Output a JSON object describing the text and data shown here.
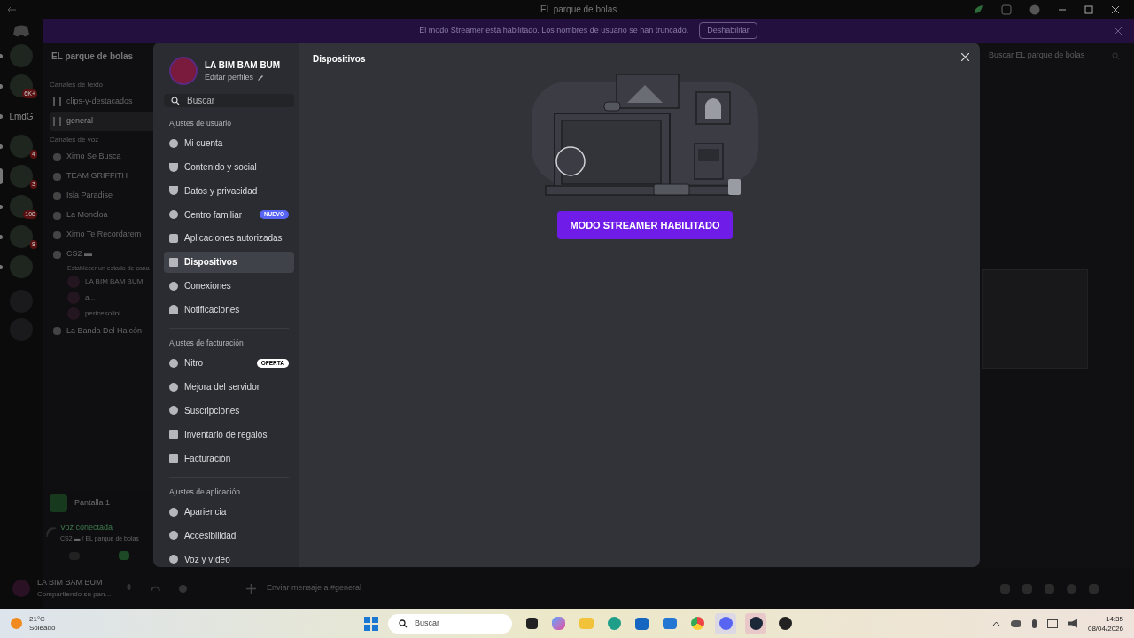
{
  "window": {
    "title": "EL parque de bolas"
  },
  "banner": {
    "text": "El modo Streamer está habilitado. Los nombres de usuario se han truncado.",
    "button": "Deshabilitar"
  },
  "server_rail": {
    "items": [
      {
        "kind": "server",
        "selected": false
      },
      {
        "kind": "server",
        "badge": "6K+",
        "selected": false
      },
      {
        "kind": "text",
        "label": "LmdG",
        "selected": false
      },
      {
        "kind": "server",
        "badge": "4",
        "selected": false
      },
      {
        "kind": "server",
        "badge": "3",
        "selected": true
      },
      {
        "kind": "server",
        "badge": "108",
        "selected": false
      },
      {
        "kind": "server",
        "badge": "8",
        "selected": false
      },
      {
        "kind": "server",
        "selected": false
      }
    ]
  },
  "channels": {
    "server_name": "EL parque de bolas",
    "groups": [
      {
        "title": "Canales de texto",
        "items": [
          {
            "kind": "text",
            "name": "clips-y-destacados",
            "selected": false
          },
          {
            "kind": "text",
            "name": "general",
            "selected": true
          }
        ]
      },
      {
        "title": "Canales de voz",
        "items": [
          {
            "kind": "voice",
            "name": "Ximo Se Busca",
            "selected": false
          },
          {
            "kind": "voice",
            "name": "TEAM GRIFFITH",
            "selected": false
          },
          {
            "kind": "voice",
            "name": "Isla Paradise",
            "selected": false
          },
          {
            "kind": "voice",
            "name": "La Moncloa",
            "selected": false
          },
          {
            "kind": "voice",
            "name": "Ximo Te Recordarem",
            "selected": false
          },
          {
            "kind": "voice",
            "name": "CS2 ▬",
            "status": "Establecer un estado de cana",
            "selected": false,
            "children": [
              {
                "name": "LA BIM BAM BUM"
              },
              {
                "name": "a..."
              },
              {
                "name": "pericesolini"
              }
            ]
          },
          {
            "kind": "voice",
            "name": "La Banda Del Halcón",
            "selected": false
          }
        ]
      }
    ]
  },
  "stream_panel": {
    "title": "Pantalla 1",
    "voice_status": "Voz conectada",
    "voice_channel": "CS2 ▬ / EL parque de bolas"
  },
  "user_panel": {
    "name": "LA BIM BAM BUM",
    "status": "Compartiendo su pan..."
  },
  "member_search": {
    "placeholder": "Buscar EL parque de bolas"
  },
  "message_input": {
    "placeholder": "Enviar mensaje a #general"
  },
  "settings": {
    "profile_name": "LA BIM BAM BUM",
    "edit_profiles": "Editar perfiles",
    "search": {
      "placeholder": "Buscar"
    },
    "sections": [
      {
        "title": "Ajustes de usuario",
        "items": [
          {
            "label": "Mi cuenta",
            "selected": false
          },
          {
            "label": "Contenido y social",
            "selected": false
          },
          {
            "label": "Datos y privacidad",
            "selected": false
          },
          {
            "label": "Centro familiar",
            "badge": {
              "kind": "new",
              "text": "NUEVO"
            },
            "selected": false
          },
          {
            "label": "Aplicaciones autorizadas",
            "selected": false
          },
          {
            "label": "Dispositivos",
            "selected": true
          },
          {
            "label": "Conexiones",
            "selected": false
          },
          {
            "label": "Notificaciones",
            "selected": false
          }
        ]
      },
      {
        "title": "Ajustes de facturación",
        "items": [
          {
            "label": "Nitro",
            "badge": {
              "kind": "offer",
              "text": "OFERTA"
            },
            "selected": false
          },
          {
            "label": "Mejora del servidor",
            "selected": false
          },
          {
            "label": "Suscripciones",
            "selected": false
          },
          {
            "label": "Inventario de regalos",
            "selected": false
          },
          {
            "label": "Facturación",
            "selected": false
          }
        ]
      },
      {
        "title": "Ajustes de aplicación",
        "items": [
          {
            "label": "Apariencia",
            "selected": false
          },
          {
            "label": "Accesibilidad",
            "selected": false
          },
          {
            "label": "Voz y vídeo",
            "selected": false
          }
        ]
      }
    ],
    "page_title": "Dispositivos",
    "streamer_button": "MODO STREAMER HABILITADO"
  },
  "taskbar": {
    "temperature": "21°C",
    "weather": "Soleado",
    "search": {
      "placeholder": "Buscar"
    },
    "time": "14:35",
    "date": "08/04/2026"
  }
}
